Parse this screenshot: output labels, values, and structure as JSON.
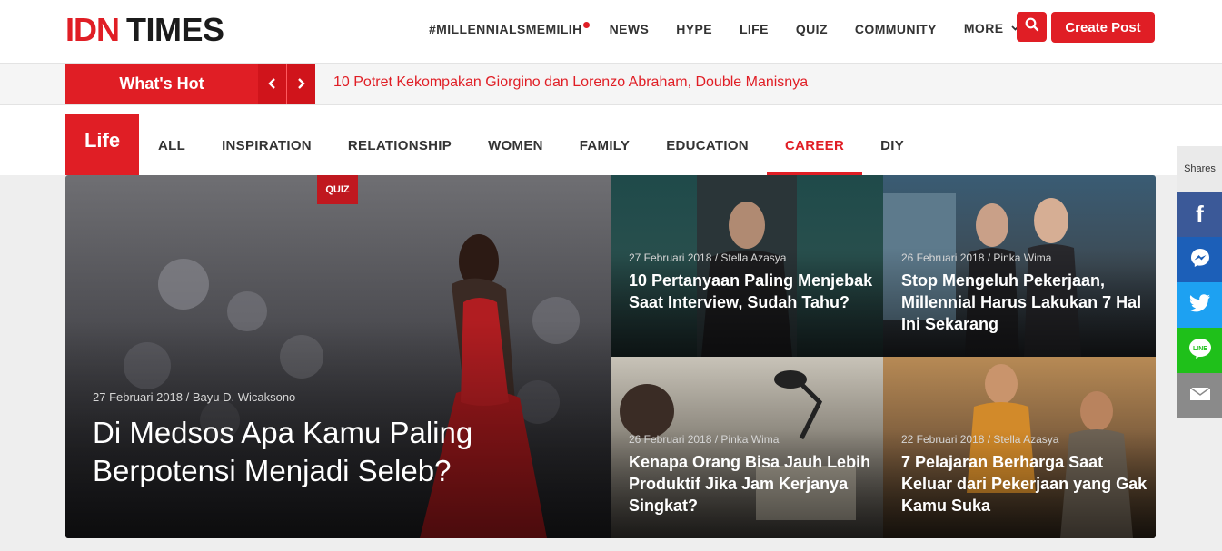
{
  "header": {
    "logo": {
      "part1": "IDN",
      "part2": "TIMES"
    },
    "nav": [
      {
        "label": "#MILLENNIALSMEMILIH"
      },
      {
        "label": "NEWS"
      },
      {
        "label": "HYPE"
      },
      {
        "label": "LIFE"
      },
      {
        "label": "QUIZ"
      },
      {
        "label": "COMMUNITY"
      },
      {
        "label": "MORE"
      }
    ],
    "create_post": "Create Post"
  },
  "whats_hot": {
    "label": "What's Hot",
    "prev_icon": "‹",
    "next_icon": "›",
    "headline": "10 Potret Kekompakan Giorgino dan Lorenzo Abraham, Double Manisnya"
  },
  "category": {
    "title": "Life",
    "tabs": [
      "ALL",
      "INSPIRATION",
      "RELATIONSHIP",
      "WOMEN",
      "FAMILY",
      "EDUCATION",
      "CAREER",
      "DIY"
    ],
    "active_tab": "CAREER"
  },
  "articles": {
    "hero": {
      "badge": "QUIZ",
      "meta": "27 Februari 2018 / Bayu D. Wicaksono",
      "title": "Di Medsos Apa Kamu Paling Berpotensi Menjadi Seleb?"
    },
    "items": [
      {
        "meta": "27 Februari 2018 / Stella Azasya",
        "title": "10 Pertanyaan Paling Menjebak Saat Interview, Sudah Tahu?"
      },
      {
        "meta": "26 Februari 2018 / Pinka Wima",
        "title": "Stop Mengeluh Pekerjaan, Millennial Harus Lakukan 7 Hal Ini Sekarang"
      },
      {
        "meta": "26 Februari 2018 / Pinka Wima",
        "title": "Kenapa Orang Bisa Jauh Lebih Produktif Jika Jam Kerjanya Singkat?"
      },
      {
        "meta": "22 Februari 2018 / Stella Azasya",
        "title": "7 Pelajaran Berharga Saat Keluar dari Pekerjaan yang Gak Kamu Suka"
      }
    ]
  },
  "share": {
    "label": "Shares",
    "buttons": [
      "facebook-icon",
      "messenger-icon",
      "twitter-icon",
      "line-icon",
      "email-icon"
    ]
  },
  "colors": {
    "brand": "#e01e25",
    "facebook": "#3b5998",
    "twitter": "#1da1f2",
    "line": "#1fc01a"
  }
}
